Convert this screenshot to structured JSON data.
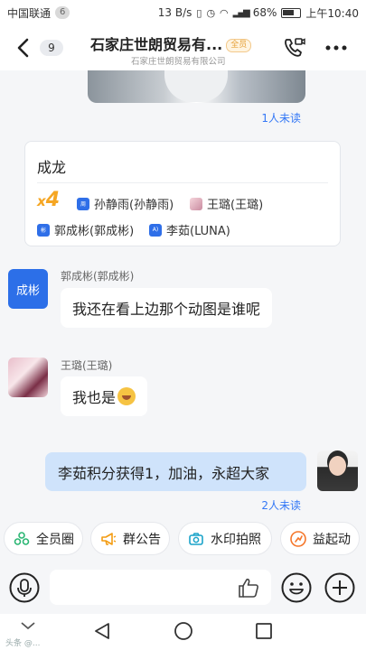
{
  "status_bar": {
    "carrier": "中国联通",
    "carrier_badge": "6",
    "speed": "13 B/s",
    "battery": "68%",
    "time": "上午10:40"
  },
  "header": {
    "back_count": "9",
    "title": "石家庄世朗贸易有...",
    "title_tag": "全员",
    "subtitle": "石家庄世朗贸易有限公司"
  },
  "messages": {
    "image_unread": "1人未读",
    "card": {
      "name": "成龙",
      "multiplier_x": "x",
      "multiplier_n": "4",
      "recipients": [
        {
          "avatar": "周",
          "name": "孙静雨(孙静雨)"
        },
        {
          "avatar": "",
          "name": "王璐(王璐)"
        },
        {
          "avatar": "彬",
          "name": "郭成彬(郭成彬)"
        },
        {
          "avatar": "A)",
          "name": "李茹(LUNA)"
        }
      ]
    },
    "msg1": {
      "avatar_text": "成彬",
      "sender": "郭成彬(郭成彬)",
      "text": "我还在看上边那个动图是谁呢"
    },
    "msg2": {
      "sender": "王璐(王璐)",
      "text": "我也是"
    },
    "msg3": {
      "text": "李茹积分获得1，加油，永超大家",
      "unread": "2人未读"
    }
  },
  "quick_actions": [
    {
      "label": "全员圈",
      "icon": "circles-icon",
      "color": "#2bb673"
    },
    {
      "label": "群公告",
      "icon": "megaphone-icon",
      "color": "#f39c12"
    },
    {
      "label": "水印拍照",
      "icon": "camera-icon",
      "color": "#1aa3c9"
    },
    {
      "label": "益起动",
      "icon": "run-icon",
      "color": "#f5762a"
    }
  ],
  "input": {
    "placeholder": ""
  },
  "watermark": "头条 @..."
}
